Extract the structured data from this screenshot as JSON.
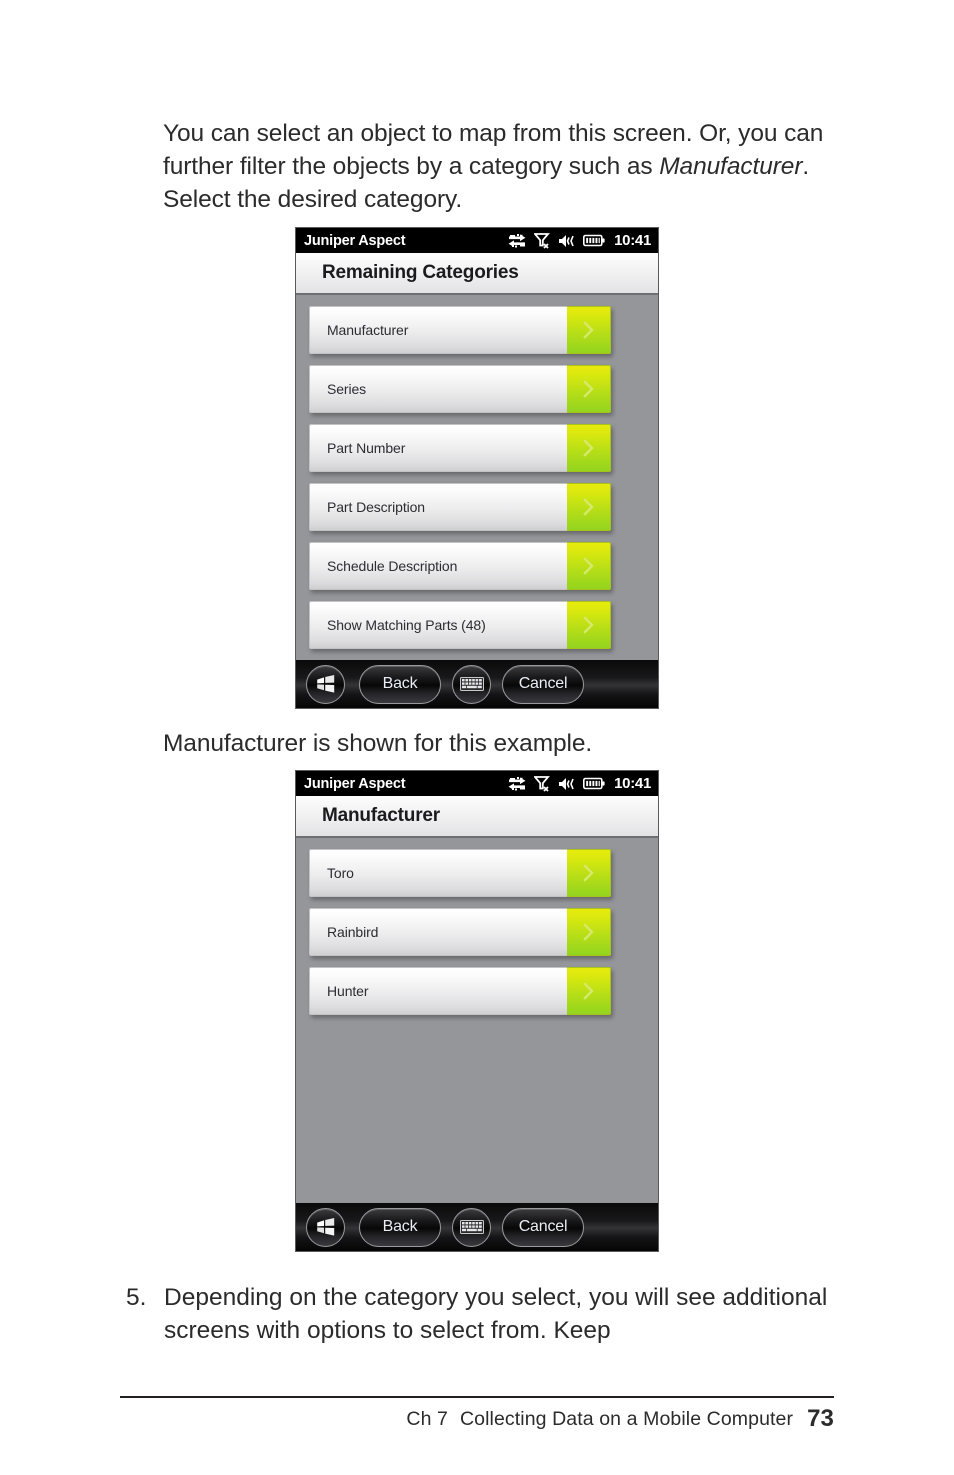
{
  "page": {
    "intro_paragraph_1": "You can select an object to map from this screen. Or, you can further filter the objects by a category such as ",
    "intro_italic": "Manufacturer",
    "intro_paragraph_2": ". Select the desired category.",
    "middle_paragraph": "Manufacturer is shown for this example.",
    "step_number": "5.",
    "step_text": "Depending on the category you select, you will see additional screens with options to select from. Keep"
  },
  "footer": {
    "chapter": "Ch 7",
    "title": "Collecting Data on a Mobile Computer",
    "page_number": "73"
  },
  "device1": {
    "titlebar": {
      "app_name": "Juniper Aspect",
      "clock": "10:41",
      "icons": [
        "connectivity-icon",
        "signal-no-service-icon",
        "speaker-icon",
        "battery-icon"
      ]
    },
    "screen_title": "Remaining Categories",
    "items": [
      {
        "label": "Manufacturer"
      },
      {
        "label": "Series"
      },
      {
        "label": "Part Number"
      },
      {
        "label": "Part Description"
      },
      {
        "label": "Schedule Description"
      },
      {
        "label": "Show Matching Parts (48)"
      }
    ],
    "taskbar": {
      "start_label": "start-button",
      "back_label": "Back",
      "keyboard_label": "keyboard-button",
      "cancel_label": "Cancel"
    }
  },
  "device2": {
    "titlebar": {
      "app_name": "Juniper Aspect",
      "clock": "10:41",
      "icons": [
        "connectivity-icon",
        "signal-no-service-icon",
        "speaker-icon",
        "battery-icon"
      ]
    },
    "screen_title": "Manufacturer",
    "items": [
      {
        "label": "Toro"
      },
      {
        "label": "Rainbird"
      },
      {
        "label": "Hunter"
      }
    ],
    "taskbar": {
      "start_label": "start-button",
      "back_label": "Back",
      "keyboard_label": "keyboard-button",
      "cancel_label": "Cancel"
    }
  },
  "colors": {
    "accent_green": "#b4dd18",
    "accent_yellow": "#e8eb0c",
    "screen_background": "#95969a",
    "titlebar_background": "#000000"
  }
}
